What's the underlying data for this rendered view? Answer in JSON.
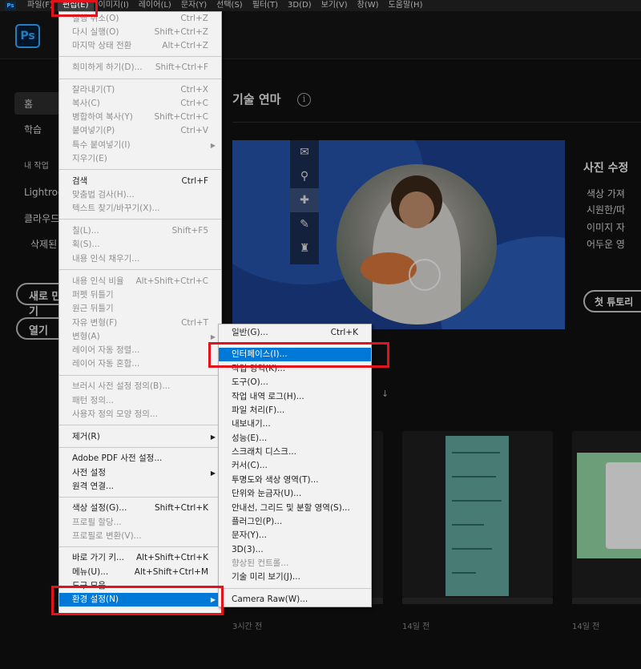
{
  "menubar": {
    "items": [
      "파일(F)",
      "편집(E)",
      "이미지(I)",
      "레이어(L)",
      "문자(Y)",
      "선택(S)",
      "필터(T)",
      "3D(D)",
      "보기(V)",
      "창(W)",
      "도움말(H)"
    ],
    "app_badge": "Ps"
  },
  "header": {
    "logo": "Ps"
  },
  "home": {
    "nav": [
      "홈",
      "학습",
      "내 작업",
      "Lightroom",
      "클라우드",
      "삭제된"
    ],
    "new_button": "새로 만들기",
    "open_button": "열기"
  },
  "main": {
    "section_title": "기술 연마",
    "info_glyph": "i",
    "hero": {
      "title": "사진 수정",
      "bullets": [
        "색상 가져",
        "시원한/따",
        "이미지 자",
        "어두운 영"
      ],
      "tutorial_button": "첫 튜토리"
    },
    "sort_glyph": "↓",
    "recent_times": [
      "3시간 전",
      "14일 전",
      "14일 전"
    ]
  },
  "edit_menu": {
    "items": [
      {
        "label": "실행 취소(O)",
        "shortcut": "Ctrl+Z",
        "disabled": true
      },
      {
        "label": "다시 실행(O)",
        "shortcut": "Shift+Ctrl+Z",
        "disabled": true
      },
      {
        "label": "마지막 상태 전환",
        "shortcut": "Alt+Ctrl+Z",
        "disabled": true
      },
      {
        "label": "희미하게 하기(D)...",
        "shortcut": "Shift+Ctrl+F",
        "disabled": true
      },
      {
        "label": "잘라내기(T)",
        "shortcut": "Ctrl+X",
        "disabled": true
      },
      {
        "label": "복사(C)",
        "shortcut": "Ctrl+C",
        "disabled": true
      },
      {
        "label": "병합하여 복사(Y)",
        "shortcut": "Shift+Ctrl+C",
        "disabled": true
      },
      {
        "label": "붙여넣기(P)",
        "shortcut": "Ctrl+V",
        "disabled": true
      },
      {
        "label": "특수 붙여넣기(I)",
        "shortcut": "",
        "disabled": true,
        "submenu": true
      },
      {
        "label": "지우기(E)",
        "shortcut": "",
        "disabled": true
      },
      {
        "label": "검색",
        "shortcut": "Ctrl+F",
        "disabled": false
      },
      {
        "label": "맞춤법 검사(H)...",
        "shortcut": "",
        "disabled": true
      },
      {
        "label": "텍스트 찾기/바꾸기(X)...",
        "shortcut": "",
        "disabled": true
      },
      {
        "label": "칠(L)...",
        "shortcut": "Shift+F5",
        "disabled": true
      },
      {
        "label": "획(S)...",
        "shortcut": "",
        "disabled": true
      },
      {
        "label": "내용 인식 채우기...",
        "shortcut": "",
        "disabled": true
      },
      {
        "label": "내용 인식 비율",
        "shortcut": "Alt+Shift+Ctrl+C",
        "disabled": true
      },
      {
        "label": "퍼펫 뒤틀기",
        "shortcut": "",
        "disabled": true
      },
      {
        "label": "원근 뒤틀기",
        "shortcut": "",
        "disabled": true
      },
      {
        "label": "자유 변형(F)",
        "shortcut": "Ctrl+T",
        "disabled": true
      },
      {
        "label": "변형(A)",
        "shortcut": "",
        "disabled": true,
        "submenu": true
      },
      {
        "label": "레이어 자동 정렬...",
        "shortcut": "",
        "disabled": true
      },
      {
        "label": "레이어 자동 혼합...",
        "shortcut": "",
        "disabled": true
      },
      {
        "label": "브러시 사전 설정 정의(B)...",
        "shortcut": "",
        "disabled": true
      },
      {
        "label": "패턴 정의...",
        "shortcut": "",
        "disabled": true
      },
      {
        "label": "사용자 정의 모양 정의...",
        "shortcut": "",
        "disabled": true
      },
      {
        "label": "제거(R)",
        "shortcut": "",
        "disabled": false,
        "submenu": true
      },
      {
        "label": "Adobe PDF 사전 설정...",
        "shortcut": "",
        "disabled": false
      },
      {
        "label": "사전 설정",
        "shortcut": "",
        "disabled": false,
        "submenu": true
      },
      {
        "label": "원격 연결...",
        "shortcut": "",
        "disabled": false
      },
      {
        "label": "색상 설정(G)...",
        "shortcut": "Shift+Ctrl+K",
        "disabled": false
      },
      {
        "label": "프로필 할당...",
        "shortcut": "",
        "disabled": true
      },
      {
        "label": "프로필로 변환(V)...",
        "shortcut": "",
        "disabled": true
      },
      {
        "label": "바로 가기 키...",
        "shortcut": "Alt+Shift+Ctrl+K",
        "disabled": false
      },
      {
        "label": "메뉴(U)...",
        "shortcut": "Alt+Shift+Ctrl+M",
        "disabled": false
      },
      {
        "label": "도구 모음...",
        "shortcut": "",
        "disabled": false
      },
      {
        "label": "환경 설정(N)",
        "shortcut": "",
        "disabled": false,
        "submenu": true,
        "highlighted": true
      }
    ]
  },
  "preferences_submenu": {
    "items": [
      {
        "label": "일반(G)...",
        "shortcut": "Ctrl+K"
      },
      {
        "label": "인터페이스(I)...",
        "shortcut": "",
        "highlighted": true
      },
      {
        "label": "작업 영역(K)...",
        "shortcut": ""
      },
      {
        "label": "도구(O)...",
        "shortcut": ""
      },
      {
        "label": "작업 내역 로그(H)...",
        "shortcut": ""
      },
      {
        "label": "파일 처리(F)...",
        "shortcut": ""
      },
      {
        "label": "내보내기...",
        "shortcut": ""
      },
      {
        "label": "성능(E)...",
        "shortcut": ""
      },
      {
        "label": "스크래치 디스크...",
        "shortcut": ""
      },
      {
        "label": "커서(C)...",
        "shortcut": ""
      },
      {
        "label": "투명도와 색상 영역(T)...",
        "shortcut": ""
      },
      {
        "label": "단위와 눈금자(U)...",
        "shortcut": ""
      },
      {
        "label": "안내선, 그리드 및 분할 영역(S)...",
        "shortcut": ""
      },
      {
        "label": "플러그인(P)...",
        "shortcut": ""
      },
      {
        "label": "문자(Y)...",
        "shortcut": ""
      },
      {
        "label": "3D(3)...",
        "shortcut": ""
      },
      {
        "label": "향상된 컨트롤...",
        "shortcut": "",
        "disabled": true
      },
      {
        "label": "기술 미리 보기(J)...",
        "shortcut": ""
      },
      {
        "label": "Camera Raw(W)...",
        "shortcut": ""
      }
    ]
  },
  "colors": {
    "highlight": "#0078d7",
    "annotation": "#e3131b",
    "ps_blue": "#31a8ff"
  }
}
